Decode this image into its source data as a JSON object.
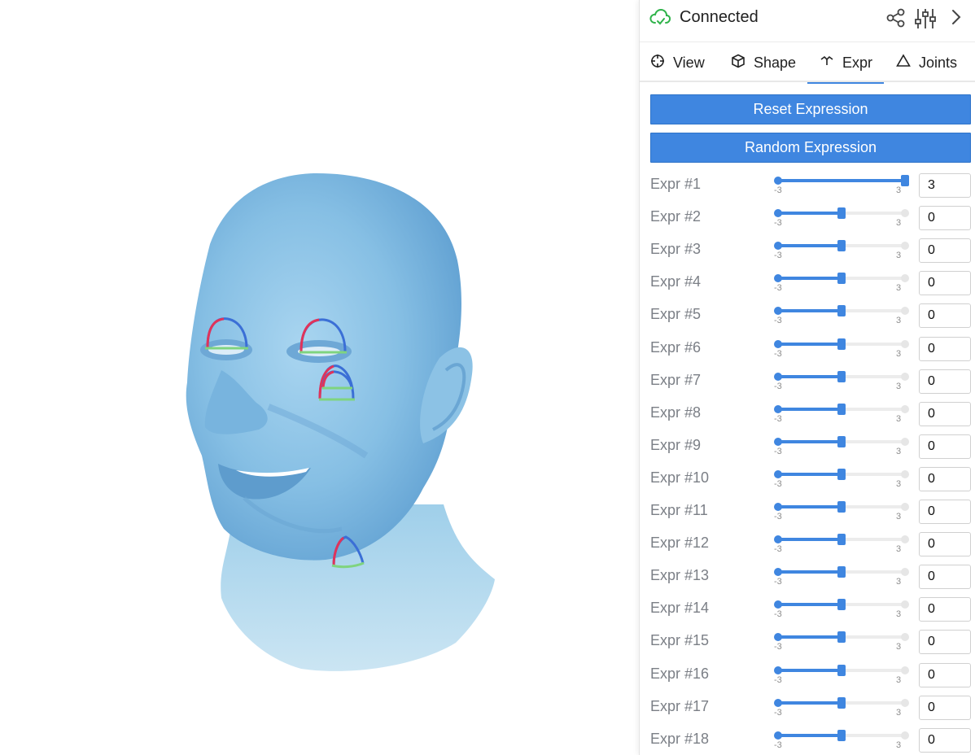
{
  "header": {
    "status": "Connected",
    "status_color": "#2fb34a",
    "icons": [
      "cloud-check-icon",
      "share-icon",
      "sliders-icon",
      "chevron-right-icon"
    ]
  },
  "tabs": [
    {
      "label": "View",
      "icon": "crosshair-icon"
    },
    {
      "label": "Shape",
      "icon": "cube-icon"
    },
    {
      "label": "Expr",
      "icon": "expression-icon",
      "active": true
    },
    {
      "label": "Joints",
      "icon": "triangle-icon"
    }
  ],
  "buttons": {
    "reset": "Reset Expression",
    "random": "Random Expression"
  },
  "accent_color": "#3f86e0",
  "slider_range": {
    "min": -3,
    "max": 3,
    "min_label": "-3",
    "max_label": "3"
  },
  "expressions": [
    {
      "label": "Expr #1",
      "value": "3"
    },
    {
      "label": "Expr #2",
      "value": "0"
    },
    {
      "label": "Expr #3",
      "value": "0"
    },
    {
      "label": "Expr #4",
      "value": "0"
    },
    {
      "label": "Expr #5",
      "value": "0"
    },
    {
      "label": "Expr #6",
      "value": "0"
    },
    {
      "label": "Expr #7",
      "value": "0"
    },
    {
      "label": "Expr #8",
      "value": "0"
    },
    {
      "label": "Expr #9",
      "value": "0"
    },
    {
      "label": "Expr #10",
      "value": "0"
    },
    {
      "label": "Expr #11",
      "value": "0"
    },
    {
      "label": "Expr #12",
      "value": "0"
    },
    {
      "label": "Expr #13",
      "value": "0"
    },
    {
      "label": "Expr #14",
      "value": "0"
    },
    {
      "label": "Expr #15",
      "value": "0"
    },
    {
      "label": "Expr #16",
      "value": "0"
    },
    {
      "label": "Expr #17",
      "value": "0"
    },
    {
      "label": "Expr #18",
      "value": "0"
    }
  ],
  "viewport": {
    "model": "3d-head-mesh",
    "mesh_color": "#8dc3e6",
    "gizmo_colors": {
      "x": "#e0335a",
      "y": "#3b6fd6",
      "z": "#7fd47f"
    }
  }
}
